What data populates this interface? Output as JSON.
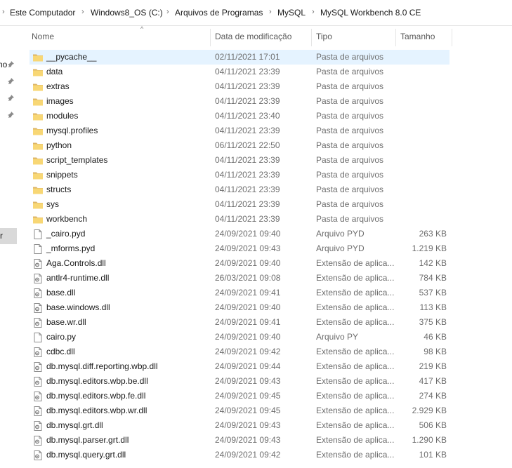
{
  "breadcrumb": [
    "Este Computador",
    "Windows8_OS (C:)",
    "Arquivos de Programas",
    "MySQL",
    "MySQL Workbench 8.0 CE"
  ],
  "nav": {
    "partial_label_top": "no",
    "partial_label_selected": "r"
  },
  "columns": {
    "name": "Nome",
    "date": "Data de modificação",
    "type": "Tipo",
    "size": "Tamanho"
  },
  "files": [
    {
      "name": "__pycache__",
      "date": "02/11/2021 17:01",
      "type": "Pasta de arquivos",
      "size": "",
      "icon": "folder-icon"
    },
    {
      "name": "data",
      "date": "04/11/2021 23:39",
      "type": "Pasta de arquivos",
      "size": "",
      "icon": "folder-icon"
    },
    {
      "name": "extras",
      "date": "04/11/2021 23:39",
      "type": "Pasta de arquivos",
      "size": "",
      "icon": "folder-icon"
    },
    {
      "name": "images",
      "date": "04/11/2021 23:39",
      "type": "Pasta de arquivos",
      "size": "",
      "icon": "folder-icon"
    },
    {
      "name": "modules",
      "date": "04/11/2021 23:40",
      "type": "Pasta de arquivos",
      "size": "",
      "icon": "folder-icon"
    },
    {
      "name": "mysql.profiles",
      "date": "04/11/2021 23:39",
      "type": "Pasta de arquivos",
      "size": "",
      "icon": "folder-icon"
    },
    {
      "name": "python",
      "date": "06/11/2021 22:50",
      "type": "Pasta de arquivos",
      "size": "",
      "icon": "folder-icon"
    },
    {
      "name": "script_templates",
      "date": "04/11/2021 23:39",
      "type": "Pasta de arquivos",
      "size": "",
      "icon": "folder-icon"
    },
    {
      "name": "snippets",
      "date": "04/11/2021 23:39",
      "type": "Pasta de arquivos",
      "size": "",
      "icon": "folder-icon"
    },
    {
      "name": "structs",
      "date": "04/11/2021 23:39",
      "type": "Pasta de arquivos",
      "size": "",
      "icon": "folder-icon"
    },
    {
      "name": "sys",
      "date": "04/11/2021 23:39",
      "type": "Pasta de arquivos",
      "size": "",
      "icon": "folder-icon"
    },
    {
      "name": "workbench",
      "date": "04/11/2021 23:39",
      "type": "Pasta de arquivos",
      "size": "",
      "icon": "folder-icon"
    },
    {
      "name": "_cairo.pyd",
      "date": "24/09/2021 09:40",
      "type": "Arquivo PYD",
      "size": "263 KB",
      "icon": "file-icon"
    },
    {
      "name": "_mforms.pyd",
      "date": "24/09/2021 09:43",
      "type": "Arquivo PYD",
      "size": "1.219 KB",
      "icon": "file-icon"
    },
    {
      "name": "Aga.Controls.dll",
      "date": "24/09/2021 09:40",
      "type": "Extensão de aplica...",
      "size": "142 KB",
      "icon": "dll-icon"
    },
    {
      "name": "antlr4-runtime.dll",
      "date": "26/03/2021 09:08",
      "type": "Extensão de aplica...",
      "size": "784 KB",
      "icon": "dll-icon"
    },
    {
      "name": "base.dll",
      "date": "24/09/2021 09:41",
      "type": "Extensão de aplica...",
      "size": "537 KB",
      "icon": "dll-icon"
    },
    {
      "name": "base.windows.dll",
      "date": "24/09/2021 09:40",
      "type": "Extensão de aplica...",
      "size": "113 KB",
      "icon": "dll-icon"
    },
    {
      "name": "base.wr.dll",
      "date": "24/09/2021 09:41",
      "type": "Extensão de aplica...",
      "size": "375 KB",
      "icon": "dll-icon"
    },
    {
      "name": "cairo.py",
      "date": "24/09/2021 09:40",
      "type": "Arquivo PY",
      "size": "46 KB",
      "icon": "file-icon"
    },
    {
      "name": "cdbc.dll",
      "date": "24/09/2021 09:42",
      "type": "Extensão de aplica...",
      "size": "98 KB",
      "icon": "dll-icon"
    },
    {
      "name": "db.mysql.diff.reporting.wbp.dll",
      "date": "24/09/2021 09:44",
      "type": "Extensão de aplica...",
      "size": "219 KB",
      "icon": "dll-icon"
    },
    {
      "name": "db.mysql.editors.wbp.be.dll",
      "date": "24/09/2021 09:43",
      "type": "Extensão de aplica...",
      "size": "417 KB",
      "icon": "dll-icon"
    },
    {
      "name": "db.mysql.editors.wbp.fe.dll",
      "date": "24/09/2021 09:45",
      "type": "Extensão de aplica...",
      "size": "274 KB",
      "icon": "dll-icon"
    },
    {
      "name": "db.mysql.editors.wbp.wr.dll",
      "date": "24/09/2021 09:45",
      "type": "Extensão de aplica...",
      "size": "2.929 KB",
      "icon": "dll-icon"
    },
    {
      "name": "db.mysql.grt.dll",
      "date": "24/09/2021 09:43",
      "type": "Extensão de aplica...",
      "size": "506 KB",
      "icon": "dll-icon"
    },
    {
      "name": "db.mysql.parser.grt.dll",
      "date": "24/09/2021 09:43",
      "type": "Extensão de aplica...",
      "size": "1.290 KB",
      "icon": "dll-icon"
    },
    {
      "name": "db.mysql.query.grt.dll",
      "date": "24/09/2021 09:42",
      "type": "Extensão de aplica...",
      "size": "101 KB",
      "icon": "dll-icon"
    }
  ]
}
